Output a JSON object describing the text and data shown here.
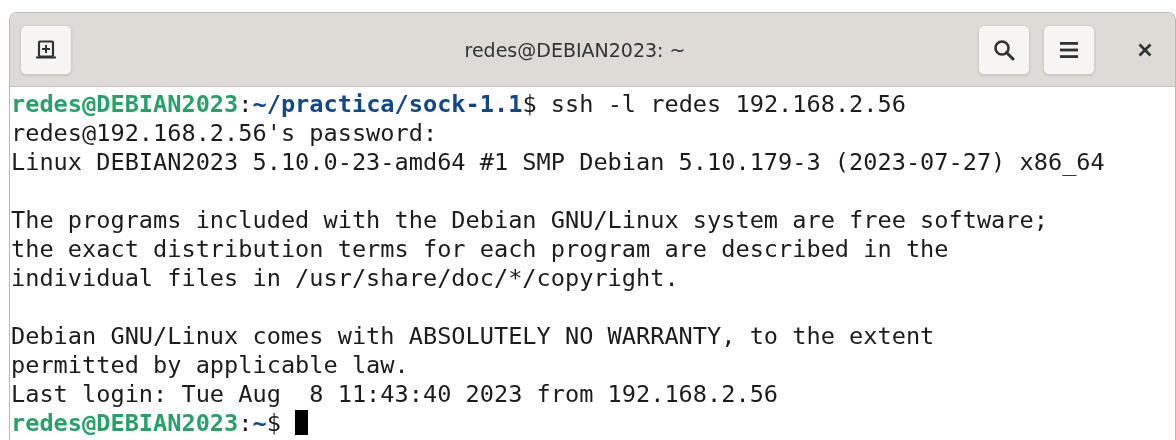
{
  "window": {
    "title": "redes@DEBIAN2023: ~"
  },
  "terminal": {
    "lines": [
      {
        "kind": "prompt",
        "user_host": "redes@DEBIAN2023",
        "colon": ":",
        "path": "~/practica/sock-1.1",
        "dollar": "$",
        "command": "ssh -l redes 192.168.2.56",
        "cursor": false
      },
      {
        "kind": "output",
        "text": "redes@192.168.2.56's password:"
      },
      {
        "kind": "output",
        "text": "Linux DEBIAN2023 5.10.0-23-amd64 #1 SMP Debian 5.10.179-3 (2023-07-27) x86_64"
      },
      {
        "kind": "blank"
      },
      {
        "kind": "output",
        "text": "The programs included with the Debian GNU/Linux system are free software;"
      },
      {
        "kind": "output",
        "text": "the exact distribution terms for each program are described in the"
      },
      {
        "kind": "output",
        "text": "individual files in /usr/share/doc/*/copyright."
      },
      {
        "kind": "blank"
      },
      {
        "kind": "output",
        "text": "Debian GNU/Linux comes with ABSOLUTELY NO WARRANTY, to the extent"
      },
      {
        "kind": "output",
        "text": "permitted by applicable law."
      },
      {
        "kind": "output",
        "text": "Last login: Tue Aug  8 11:43:40 2023 from 192.168.2.56"
      },
      {
        "kind": "prompt",
        "user_host": "redes@DEBIAN2023",
        "colon": ":",
        "path": "~",
        "dollar": "$",
        "cursor": true
      }
    ]
  }
}
